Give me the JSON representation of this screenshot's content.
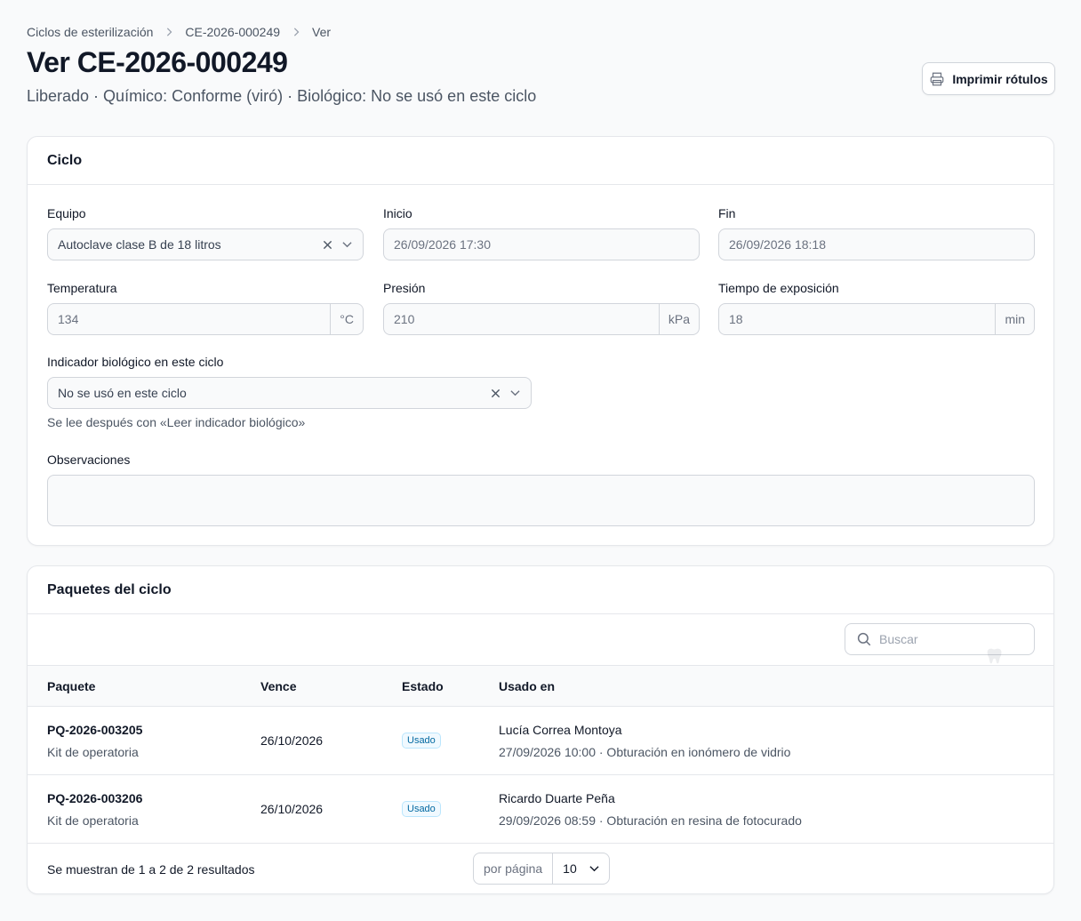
{
  "breadcrumb": {
    "items": [
      "Ciclos de esterilización",
      "CE-2026-000249",
      "Ver"
    ]
  },
  "header": {
    "title": "Ver CE-2026-000249",
    "subtitle": "Liberado · Químico: Conforme (viró) · Biológico: No se usó en este ciclo",
    "print_label": "Imprimir rótulos"
  },
  "ciclo": {
    "heading": "Ciclo",
    "equipo": {
      "label": "Equipo",
      "value": "Autoclave clase B de 18 litros"
    },
    "inicio": {
      "label": "Inicio",
      "value": "26/09/2026 17:30"
    },
    "fin": {
      "label": "Fin",
      "value": "26/09/2026 18:18"
    },
    "temperatura": {
      "label": "Temperatura",
      "value": "134",
      "unit": "°C"
    },
    "presion": {
      "label": "Presión",
      "value": "210",
      "unit": "kPa"
    },
    "tiempo": {
      "label": "Tiempo de exposición",
      "value": "18",
      "unit": "min"
    },
    "indicador": {
      "label": "Indicador biológico en este ciclo",
      "value": "No se usó en este ciclo",
      "helper": "Se lee después con «Leer indicador biológico»"
    },
    "observaciones": {
      "label": "Observaciones",
      "value": ""
    }
  },
  "paquetes": {
    "heading": "Paquetes del ciclo",
    "search_placeholder": "Buscar",
    "columns": {
      "paquete": "Paquete",
      "vence": "Vence",
      "estado": "Estado",
      "usado_en": "Usado en"
    },
    "rows": [
      {
        "code": "PQ-2026-003205",
        "type": "Kit de operatoria",
        "vence": "26/10/2026",
        "estado": "Usado",
        "usado_name": "Lucía Correa Montoya",
        "usado_detail": "27/09/2026 10:00 · Obturación en ionómero de vidrio"
      },
      {
        "code": "PQ-2026-003206",
        "type": "Kit de operatoria",
        "vence": "26/10/2026",
        "estado": "Usado",
        "usado_name": "Ricardo Duarte Peña",
        "usado_detail": "29/09/2026 08:59 · Obturación en resina de fotocurado"
      }
    ],
    "footer_text": "Se muestran de 1 a 2 de 2 resultados",
    "per_page_label": "por página",
    "per_page_value": "10"
  }
}
